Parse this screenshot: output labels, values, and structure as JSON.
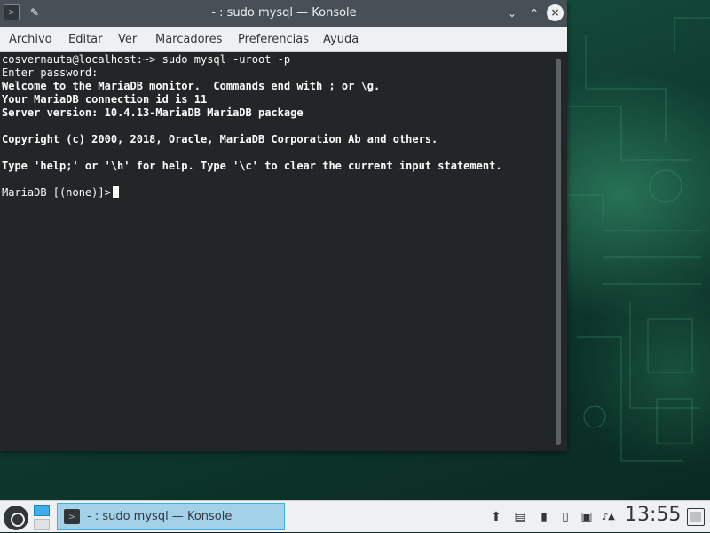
{
  "window": {
    "title": "- : sudo mysql — Konsole",
    "app_icon_glyph": ">",
    "pin_glyph": "✎",
    "minimize_glyph": "⌄",
    "maximize_glyph": "⌃",
    "close_glyph": "×"
  },
  "menubar": {
    "items": [
      "Archivo",
      "Editar",
      "Ver",
      "Marcadores",
      "Preferencias",
      "Ayuda"
    ]
  },
  "terminal": {
    "lines": [
      {
        "text": "cosvernauta@localhost:~> sudo mysql -uroot -p",
        "bold": false
      },
      {
        "text": "Enter password:",
        "bold": false
      },
      {
        "text": "Welcome to the MariaDB monitor.  Commands end with ; or \\g.",
        "bold": true
      },
      {
        "text": "Your MariaDB connection id is 11",
        "bold": true
      },
      {
        "text": "Server version: 10.4.13-MariaDB MariaDB package",
        "bold": true
      },
      {
        "text": "",
        "bold": false
      },
      {
        "text": "Copyright (c) 2000, 2018, Oracle, MariaDB Corporation Ab and others.",
        "bold": true
      },
      {
        "text": "",
        "bold": false
      },
      {
        "text": "Type 'help;' or '\\h' for help. Type '\\c' to clear the current input statement.",
        "bold": true
      },
      {
        "text": "",
        "bold": false
      },
      {
        "text": "MariaDB [(none)]>",
        "bold": false
      }
    ]
  },
  "taskbar": {
    "task_label": "- : sudo mysql — Konsole",
    "task_icon_glyph": ">",
    "clock": "13:55",
    "tray_icons": [
      "update-icon",
      "clipboard-icon",
      "usb-icon",
      "phone-icon",
      "network-icon",
      "volume-icon",
      "expand-icon"
    ],
    "tray_glyphs": [
      "⬆",
      "▤",
      "▮",
      "▯",
      "▣",
      "🔊",
      "▲"
    ]
  },
  "colors": {
    "accent": "#3daee9",
    "titlebar": "#475057",
    "terminal_bg": "#232627"
  }
}
